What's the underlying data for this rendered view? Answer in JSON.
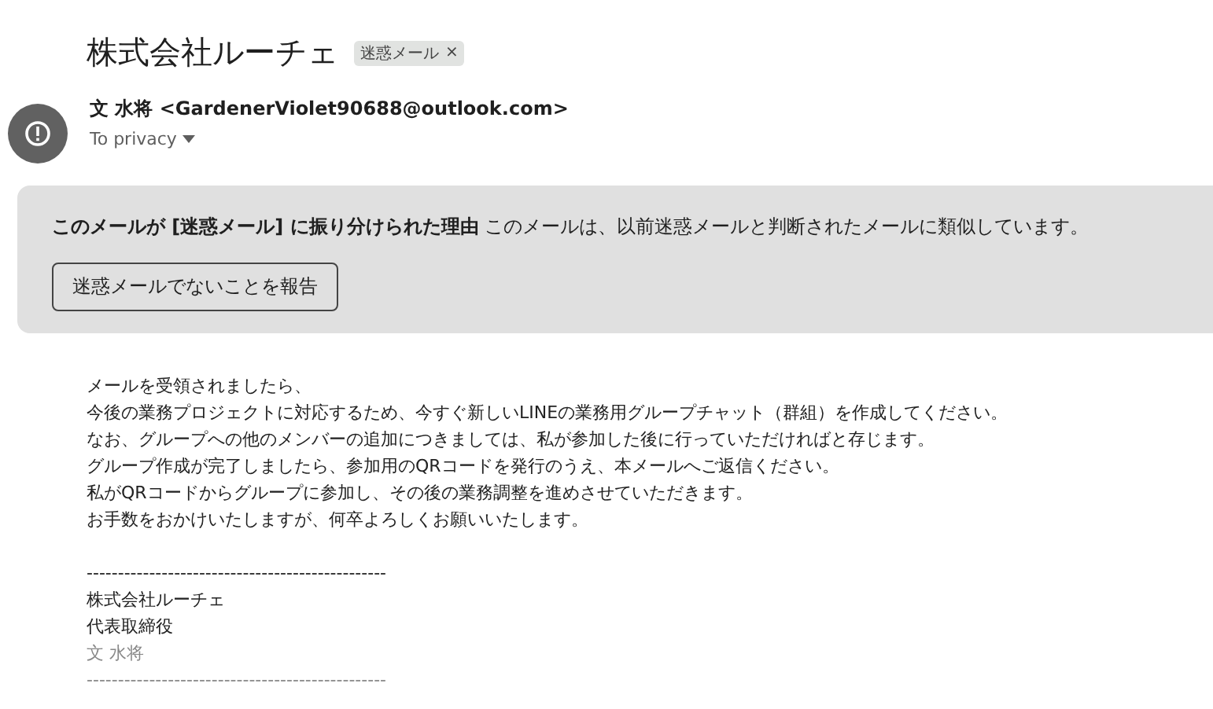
{
  "subject": "株式会社ルーチェ",
  "label": {
    "text": "迷惑メール",
    "remove": "×"
  },
  "sender": {
    "name": "文 水将",
    "address": "<GardenerViolet90688@outlook.com>",
    "recipient": "To privacy"
  },
  "spam_banner": {
    "reason_title": "このメールが [迷惑メール] に振り分けられた理由",
    "reason": "このメールは、以前迷惑メールと判断されたメールに類似しています。",
    "button": "迷惑メールでないことを報告"
  },
  "body": [
    {
      "text": "メールを受領されましたら、",
      "muted": false
    },
    {
      "text": "今後の業務プロジェクトに対応するため、今すぐ新しいLINEの業務用グループチャット（群組）を作成してください。",
      "muted": false
    },
    {
      "text": "なお、グループへの他のメンバーの追加につきましては、私が参加した後に行っていただければと存じます。",
      "muted": false
    },
    {
      "text": "グループ作成が完了しましたら、参加用のQRコードを発行のうえ、本メールへご返信ください。",
      "muted": false
    },
    {
      "text": "私がQRコードからグループに参加し、その後の業務調整を進めさせていただきます。",
      "muted": false
    },
    {
      "text": "お手数をおかけいたしますが、何卒よろしくお願いいたします。",
      "muted": false
    },
    {
      "kind": "blank"
    },
    {
      "text": "------------------------------------------------",
      "muted": false
    },
    {
      "text": "株式会社ルーチェ",
      "muted": false
    },
    {
      "text": "代表取締役",
      "muted": false
    },
    {
      "text": "文 水将",
      "muted": true
    },
    {
      "text": "------------------------------------------------",
      "muted": true
    }
  ]
}
